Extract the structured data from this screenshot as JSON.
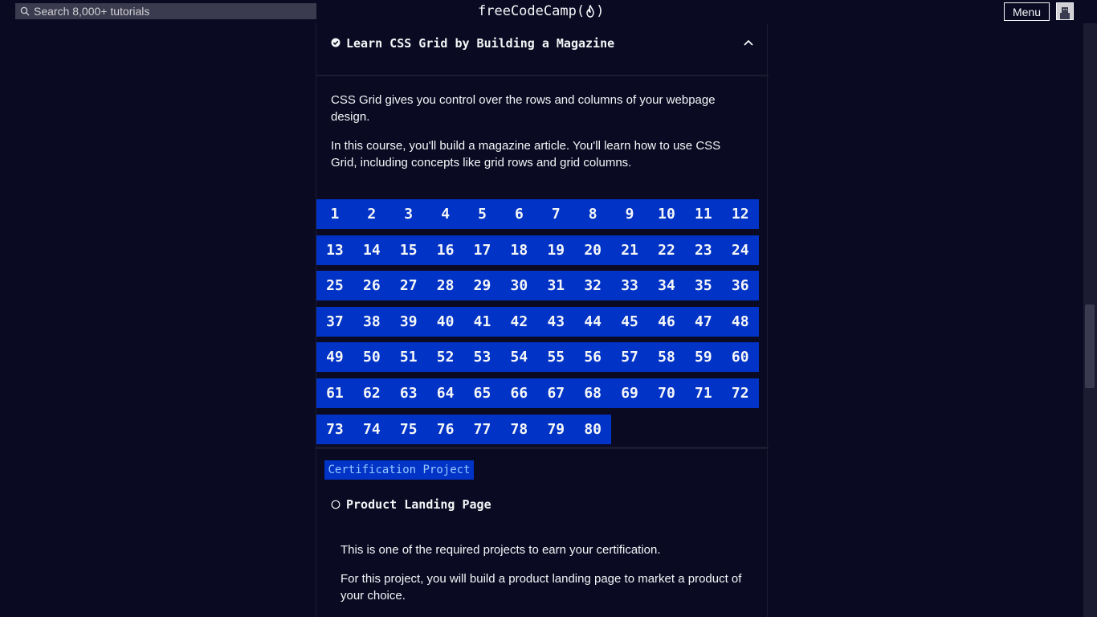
{
  "navbar": {
    "search_placeholder": "Search 8,000+ tutorials",
    "logo_text_left": "freeCodeCamp(",
    "logo_text_right": ")",
    "menu_label": "Menu"
  },
  "block": {
    "title": "Learn CSS Grid by Building a Magazine",
    "paragraphs": [
      "CSS Grid gives you control over the rows and columns of your webpage design.",
      "In this course, you'll build a magazine article. You'll learn how to use CSS Grid, including concepts like grid rows and grid columns."
    ],
    "steps": [
      "1",
      "2",
      "3",
      "4",
      "5",
      "6",
      "7",
      "8",
      "9",
      "10",
      "11",
      "12",
      "13",
      "14",
      "15",
      "16",
      "17",
      "18",
      "19",
      "20",
      "21",
      "22",
      "23",
      "24",
      "25",
      "26",
      "27",
      "28",
      "29",
      "30",
      "31",
      "32",
      "33",
      "34",
      "35",
      "36",
      "37",
      "38",
      "39",
      "40",
      "41",
      "42",
      "43",
      "44",
      "45",
      "46",
      "47",
      "48",
      "49",
      "50",
      "51",
      "52",
      "53",
      "54",
      "55",
      "56",
      "57",
      "58",
      "59",
      "60",
      "61",
      "62",
      "63",
      "64",
      "65",
      "66",
      "67",
      "68",
      "69",
      "70",
      "71",
      "72",
      "73",
      "74",
      "75",
      "76",
      "77",
      "78",
      "79",
      "80"
    ]
  },
  "project": {
    "badge": "Certification Project",
    "title": "Product Landing Page",
    "paragraphs": [
      "This is one of the required projects to earn your certification.",
      "For this project, you will build a product landing page to market a product of your choice."
    ]
  },
  "colors": {
    "background": "#0a0a23",
    "step_bg": "#0033c6",
    "badge_text": "#99c9ff"
  }
}
